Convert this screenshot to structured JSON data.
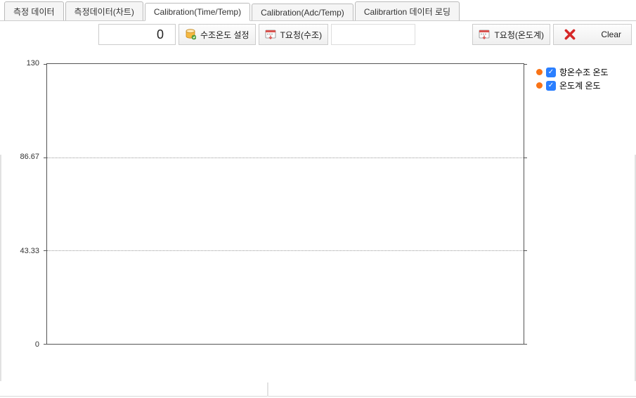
{
  "tabs": {
    "items": [
      {
        "label": "측정 데이터"
      },
      {
        "label": "측정데이터(차트)"
      },
      {
        "label": "Calibration(Time/Temp)"
      },
      {
        "label": "Calibration(Adc/Temp)"
      },
      {
        "label": "Calibrartion 데이터 로딩"
      }
    ],
    "activeIndex": 2
  },
  "toolbar": {
    "value": "0",
    "btn_set_temp": "수조온도 설정",
    "btn_request_tank": "T요청(수조)",
    "btn_request_thermo": "T요청(온도계)",
    "btn_clear": "Clear"
  },
  "chart_data": {
    "type": "line",
    "series": [
      {
        "name": "항온수조 온도",
        "values": [],
        "color": "#f97316"
      },
      {
        "name": "온도계 온도",
        "values": [],
        "color": "#f97316"
      }
    ],
    "x": [],
    "ylim": [
      0,
      130
    ],
    "y_ticks": [
      130.0,
      86.67,
      43.33,
      0.0
    ],
    "title": "",
    "xlabel": "",
    "ylabel": ""
  },
  "legend": {
    "items": [
      {
        "label": "항온수조 온도",
        "checked": true,
        "color": "#f97316"
      },
      {
        "label": "온도계 온도",
        "checked": true,
        "color": "#f97316"
      }
    ]
  }
}
